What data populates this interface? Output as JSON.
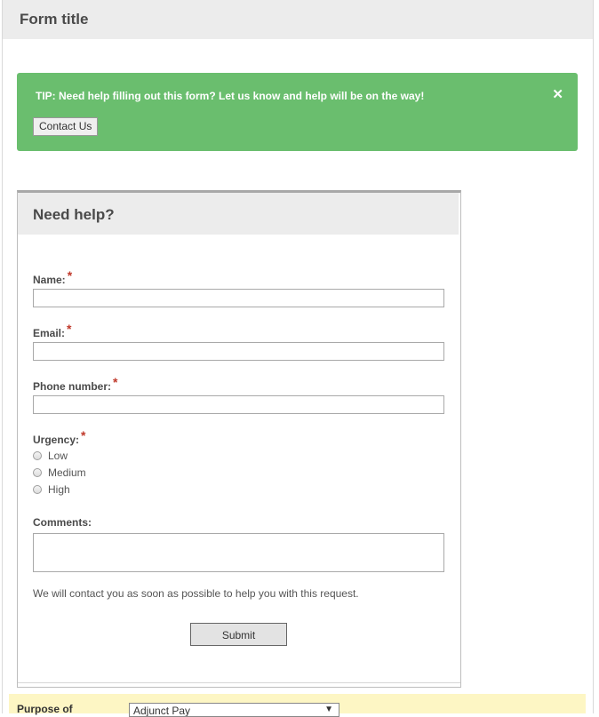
{
  "form": {
    "title": "Form title"
  },
  "tip": {
    "text": "TIP: Need help filling out this form? Let us know and help will be on the way!",
    "close_glyph": "✕",
    "contact_button": "Contact Us",
    "color": "#6abe6e"
  },
  "help": {
    "title": "Need help?",
    "fields": {
      "name_label": "Name:",
      "email_label": "Email:",
      "phone_label": "Phone number:",
      "urgency_label": "Urgency:",
      "comments_label": "Comments:",
      "required_mark": "*"
    },
    "urgency_options": [
      "Low",
      "Medium",
      "High"
    ],
    "notice": "We will contact you as soon as possible to help you with this request.",
    "submit_label": "Submit"
  },
  "purpose": {
    "label": "Purpose of",
    "selected": "Adjunct Pay",
    "arrow_glyph": "▼",
    "background": "#fdf6c4"
  }
}
